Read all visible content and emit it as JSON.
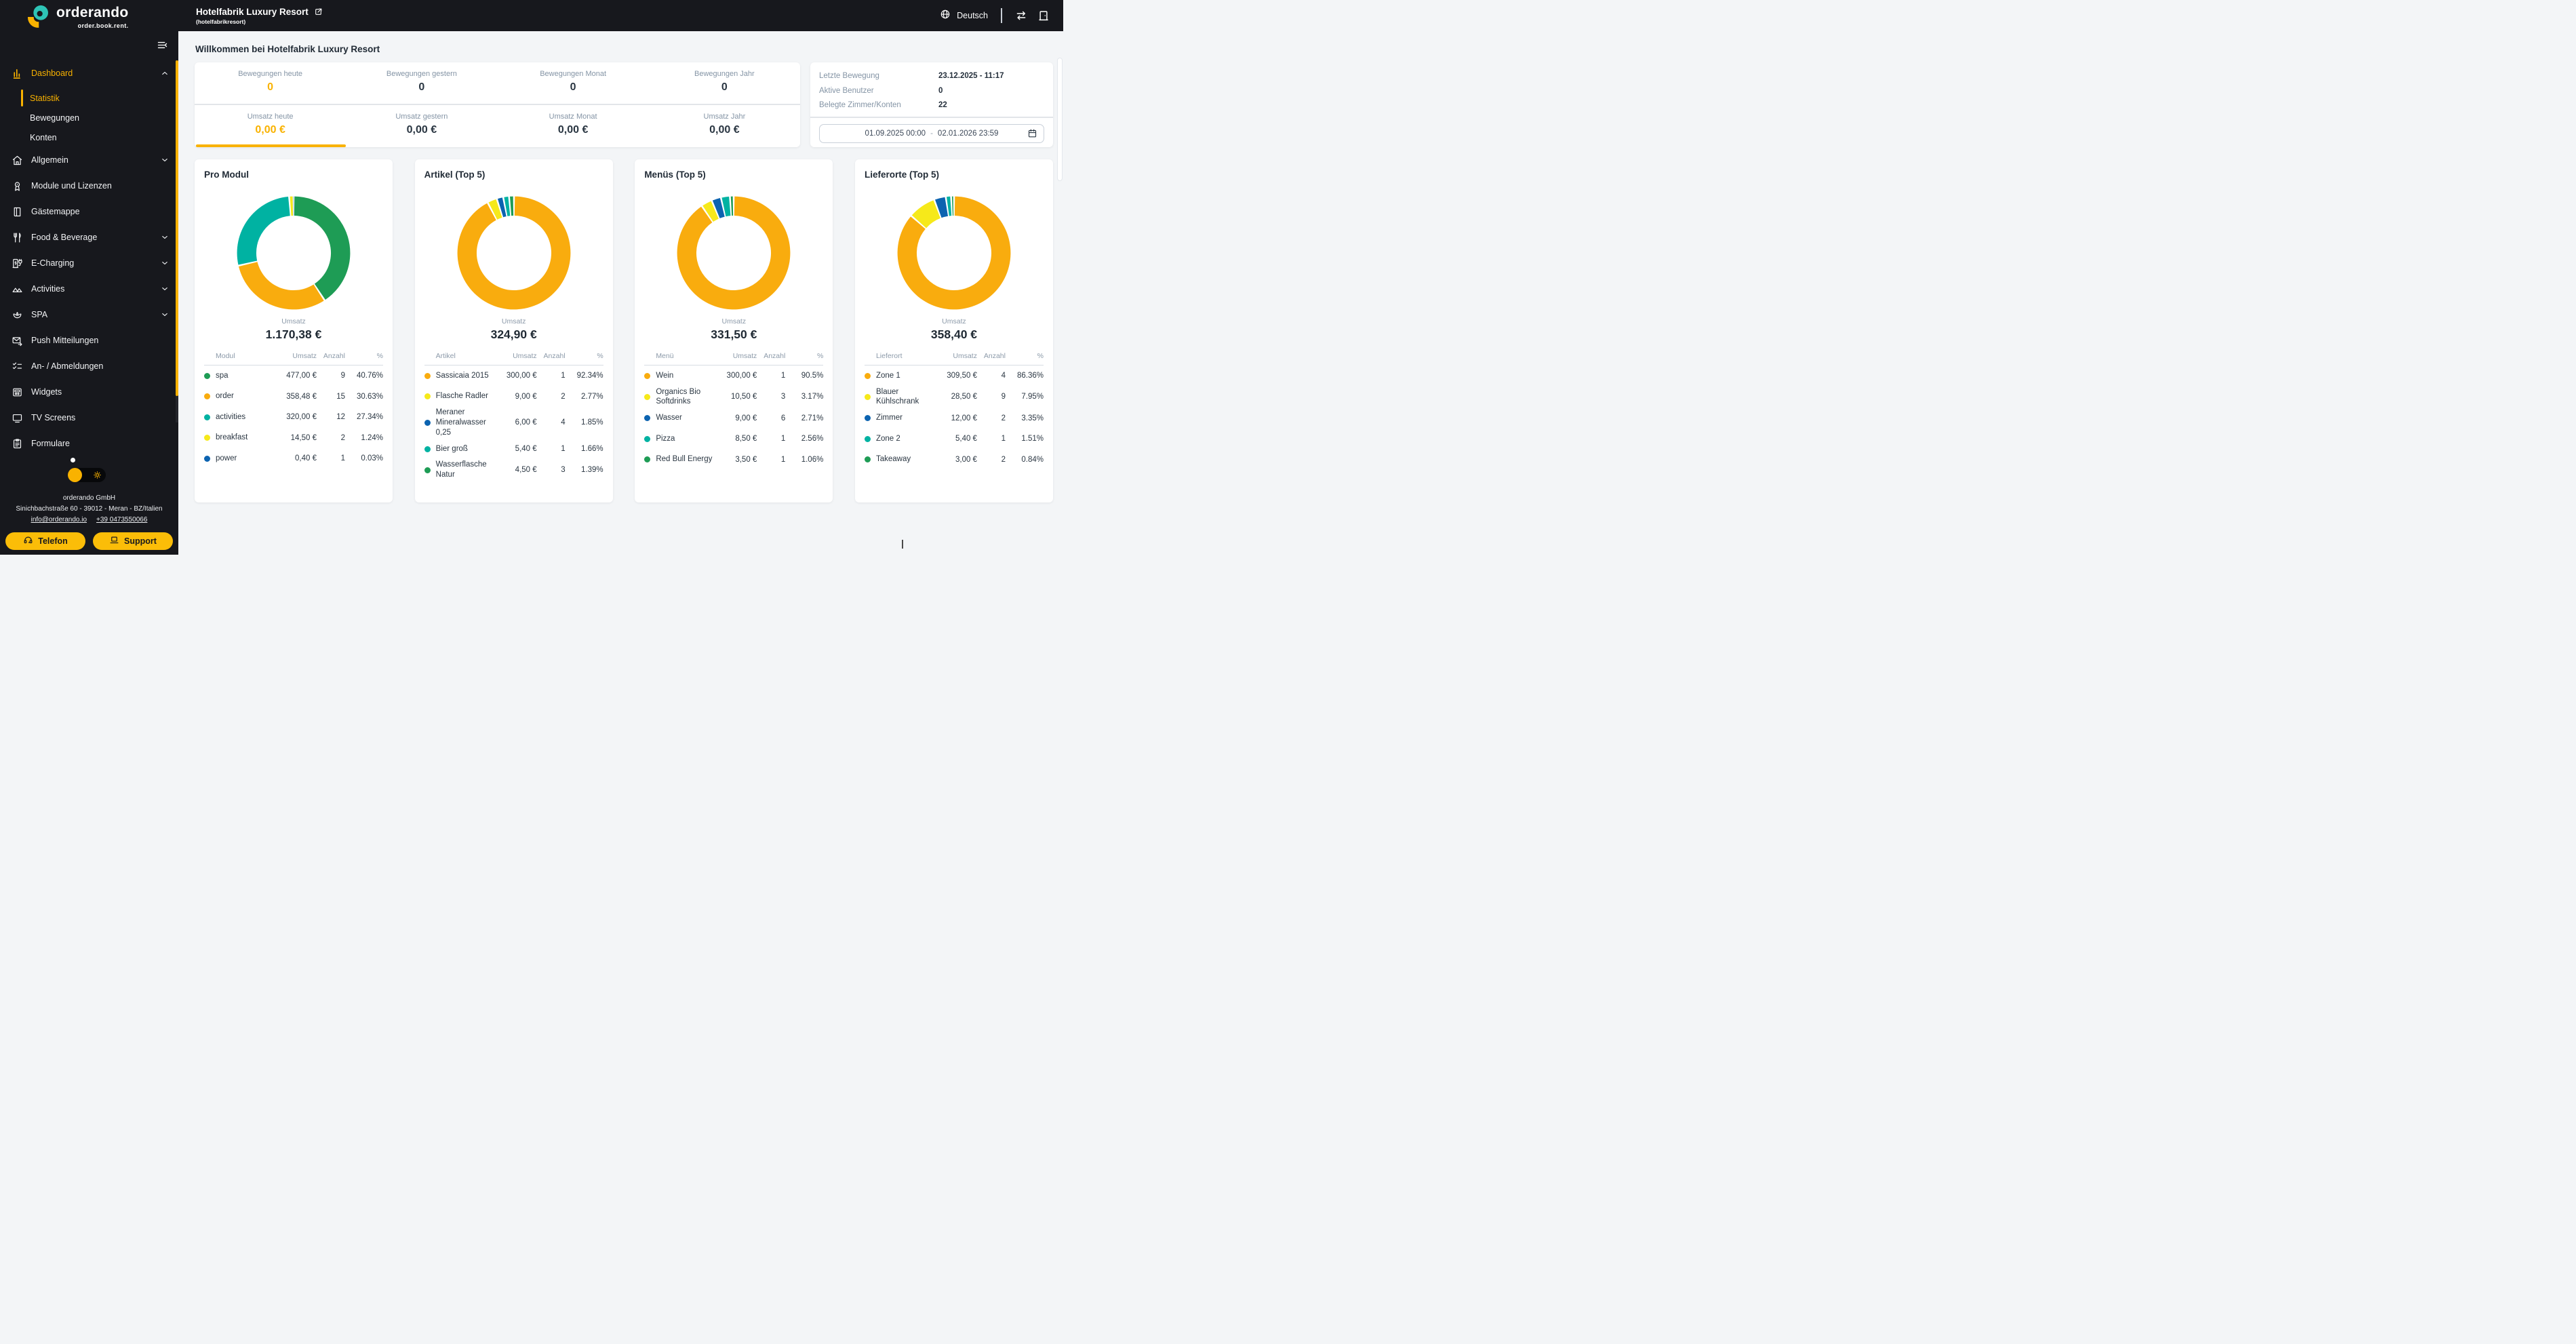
{
  "brand": {
    "name": "orderando",
    "tagline": "order.book.rent."
  },
  "header": {
    "title": "Hotelfabrik Luxury Resort",
    "subtitle": "(hotelfabrikresort)",
    "language": "Deutsch"
  },
  "colors": {
    "accent": "#F9B200",
    "button_yellow": "#FBBD08",
    "sidebar_bg": "#17181D",
    "orange": "#F9AC0E",
    "yellow": "#F6E91A",
    "blue": "#0C63B0",
    "teal": "#00B2A2",
    "green": "#1E9C55"
  },
  "sidebar": {
    "items": [
      {
        "label": "Dashboard",
        "icon": "bar-chart-icon",
        "accent": true,
        "chevron": "up"
      },
      {
        "label": "Statistik",
        "sub": true,
        "active": true
      },
      {
        "label": "Bewegungen",
        "sub": true
      },
      {
        "label": "Konten",
        "sub": true
      },
      {
        "label": "Allgemein",
        "icon": "home-icon",
        "chevron": "down"
      },
      {
        "label": "Module und Lizenzen",
        "icon": "license-icon"
      },
      {
        "label": "Gästemappe",
        "icon": "guest-folder-icon"
      },
      {
        "label": "Food & Beverage",
        "icon": "cutlery-icon",
        "chevron": "down"
      },
      {
        "label": "E-Charging",
        "icon": "ev-charger-icon",
        "chevron": "down"
      },
      {
        "label": "Activities",
        "icon": "mountains-icon",
        "chevron": "down"
      },
      {
        "label": "SPA",
        "icon": "lotus-icon",
        "chevron": "down"
      },
      {
        "label": "Push Mitteilungen",
        "icon": "mail-send-icon"
      },
      {
        "label": "An- / Abmeldungen",
        "icon": "checklist-icon"
      },
      {
        "label": "Widgets",
        "icon": "widgets-icon"
      },
      {
        "label": "TV Screens",
        "icon": "tv-icon"
      },
      {
        "label": "Formulare",
        "icon": "form-icon"
      }
    ],
    "footer": {
      "company": "orderando GmbH",
      "address": "Sinichbachstraße 60 - 39012 - Meran - BZ/Italien",
      "email": "info@orderando.io",
      "phone": "+39 0473550066",
      "buttons": [
        {
          "label": "Telefon",
          "icon": "headset-icon"
        },
        {
          "label": "Support",
          "icon": "laptop-icon"
        }
      ]
    }
  },
  "main": {
    "welcome": "Willkommen bei Hotelfabrik Luxury Resort",
    "stats": {
      "row1": [
        {
          "label": "Bewegungen heute",
          "value": "0"
        },
        {
          "label": "Bewegungen gestern",
          "value": "0"
        },
        {
          "label": "Bewegungen Monat",
          "value": "0"
        },
        {
          "label": "Bewegungen Jahr",
          "value": "0"
        }
      ],
      "row2": [
        {
          "label": "Umsatz heute",
          "value": "0,00 €"
        },
        {
          "label": "Umsatz gestern",
          "value": "0,00 €"
        },
        {
          "label": "Umsatz Monat",
          "value": "0,00 €"
        },
        {
          "label": "Umsatz Jahr",
          "value": "0,00 €"
        }
      ]
    },
    "info": {
      "rows": [
        {
          "label": "Letzte Bewegung",
          "value": "23.12.2025 - 11:17"
        },
        {
          "label": "Aktive Benutzer",
          "value": "0"
        },
        {
          "label": "Belegte Zimmer/Konten",
          "value": "22"
        }
      ],
      "date_range": {
        "start": "01.09.2025 00:00",
        "separator": "-",
        "end": "02.01.2026 23:59"
      }
    }
  },
  "chart_data": [
    {
      "type": "pie",
      "variant": "donut",
      "title": "Pro Modul",
      "center_label": "Umsatz",
      "center_value": "1.170,38 €",
      "columns": [
        "Modul",
        "Umsatz",
        "Anzahl",
        "%"
      ],
      "rows": [
        {
          "name": "spa",
          "color": "#1E9C55",
          "umsatz": "477,00 €",
          "anzahl": "9",
          "percent": 40.76,
          "percent_label": "40.76%"
        },
        {
          "name": "order",
          "color": "#F9AC0E",
          "umsatz": "358,48 €",
          "anzahl": "15",
          "percent": 30.63,
          "percent_label": "30.63%"
        },
        {
          "name": "activities",
          "color": "#00B2A2",
          "umsatz": "320,00 €",
          "anzahl": "12",
          "percent": 27.34,
          "percent_label": "27.34%"
        },
        {
          "name": "breakfast",
          "color": "#F6E91A",
          "umsatz": "14,50 €",
          "anzahl": "2",
          "percent": 1.24,
          "percent_label": "1.24%"
        },
        {
          "name": "power",
          "color": "#0C63B0",
          "umsatz": "0,40 €",
          "anzahl": "1",
          "percent": 0.03,
          "percent_label": "0.03%"
        }
      ]
    },
    {
      "type": "pie",
      "variant": "donut",
      "title": "Artikel (Top 5)",
      "center_label": "Umsatz",
      "center_value": "324,90 €",
      "columns": [
        "Artikel",
        "Umsatz",
        "Anzahl",
        "%"
      ],
      "rows": [
        {
          "name": "Sassicaia 2015",
          "color": "#F9AC0E",
          "umsatz": "300,00 €",
          "anzahl": "1",
          "percent": 92.34,
          "percent_label": "92.34%"
        },
        {
          "name": "Flasche Radler",
          "color": "#F6E91A",
          "umsatz": "9,00 €",
          "anzahl": "2",
          "percent": 2.77,
          "percent_label": "2.77%"
        },
        {
          "name": "Meraner Mineralwasser 0,25",
          "color": "#0C63B0",
          "umsatz": "6,00 €",
          "anzahl": "4",
          "percent": 1.85,
          "percent_label": "1.85%"
        },
        {
          "name": "Bier groß",
          "color": "#00B2A2",
          "umsatz": "5,40 €",
          "anzahl": "1",
          "percent": 1.66,
          "percent_label": "1.66%"
        },
        {
          "name": "Wasserflasche Natur",
          "color": "#1E9C55",
          "umsatz": "4,50 €",
          "anzahl": "3",
          "percent": 1.39,
          "percent_label": "1.39%"
        }
      ]
    },
    {
      "type": "pie",
      "variant": "donut",
      "title": "Menüs (Top 5)",
      "center_label": "Umsatz",
      "center_value": "331,50 €",
      "columns": [
        "Menü",
        "Umsatz",
        "Anzahl",
        "%"
      ],
      "rows": [
        {
          "name": "Wein",
          "color": "#F9AC0E",
          "umsatz": "300,00 €",
          "anzahl": "1",
          "percent": 90.5,
          "percent_label": "90.5%"
        },
        {
          "name": "Organics Bio Softdrinks",
          "color": "#F6E91A",
          "umsatz": "10,50 €",
          "anzahl": "3",
          "percent": 3.17,
          "percent_label": "3.17%"
        },
        {
          "name": "Wasser",
          "color": "#0C63B0",
          "umsatz": "9,00 €",
          "anzahl": "6",
          "percent": 2.71,
          "percent_label": "2.71%"
        },
        {
          "name": "Pizza",
          "color": "#00B2A2",
          "umsatz": "8,50 €",
          "anzahl": "1",
          "percent": 2.56,
          "percent_label": "2.56%"
        },
        {
          "name": "Red Bull Energy",
          "color": "#1E9C55",
          "umsatz": "3,50 €",
          "anzahl": "1",
          "percent": 1.06,
          "percent_label": "1.06%"
        }
      ]
    },
    {
      "type": "pie",
      "variant": "donut",
      "title": "Lieferorte (Top 5)",
      "center_label": "Umsatz",
      "center_value": "358,40 €",
      "columns": [
        "Lieferort",
        "Umsatz",
        "Anzahl",
        "%"
      ],
      "rows": [
        {
          "name": "Zone 1",
          "color": "#F9AC0E",
          "umsatz": "309,50 €",
          "anzahl": "4",
          "percent": 86.36,
          "percent_label": "86.36%"
        },
        {
          "name": "Blauer Kühlschrank",
          "color": "#F6E91A",
          "umsatz": "28,50 €",
          "anzahl": "9",
          "percent": 7.95,
          "percent_label": "7.95%"
        },
        {
          "name": "Zimmer",
          "color": "#0C63B0",
          "umsatz": "12,00 €",
          "anzahl": "2",
          "percent": 3.35,
          "percent_label": "3.35%"
        },
        {
          "name": "Zone 2",
          "color": "#00B2A2",
          "umsatz": "5,40 €",
          "anzahl": "1",
          "percent": 1.51,
          "percent_label": "1.51%"
        },
        {
          "name": "Takeaway",
          "color": "#1E9C55",
          "umsatz": "3,00 €",
          "anzahl": "2",
          "percent": 0.84,
          "percent_label": "0.84%"
        }
      ]
    }
  ]
}
